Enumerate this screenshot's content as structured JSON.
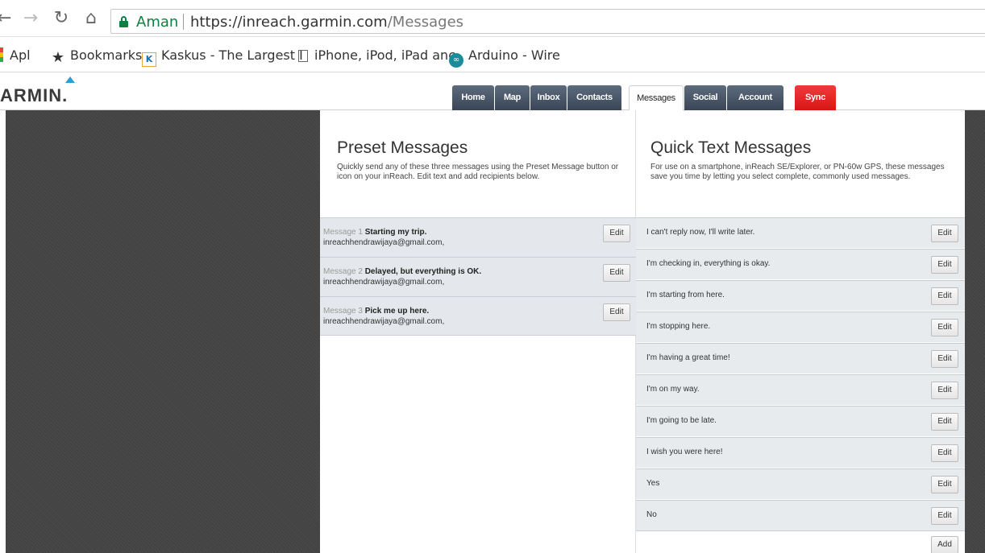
{
  "browser": {
    "secure_label": "Aman",
    "url_host": "https://inreach.garmin.com",
    "url_path": "/Messages",
    "bookmarks": [
      {
        "label": "Apl"
      },
      {
        "label": "Bookmarks"
      },
      {
        "label": "Kaskus - The Largest I"
      },
      {
        "label": "iPhone, iPod, iPad anc"
      },
      {
        "label": "Arduino - Wire"
      }
    ]
  },
  "header": {
    "logo": "ARMIN.",
    "tabs": [
      {
        "label": "Home"
      },
      {
        "label": "Map"
      },
      {
        "label": "Inbox"
      },
      {
        "label": "Contacts"
      },
      {
        "label": "Messages"
      },
      {
        "label": "Social"
      },
      {
        "label": "Account"
      },
      {
        "label": "Sync"
      }
    ]
  },
  "preset": {
    "title": "Preset Messages",
    "description": "Quickly send any of these three messages using the Preset Message button or icon on your inReach. Edit text and add recipients below.",
    "edit_label": "Edit",
    "messages": [
      {
        "prefix": "Message 1",
        "text": "Starting my trip.",
        "recipients": "inreachhendrawijaya@gmail.com,"
      },
      {
        "prefix": "Message 2",
        "text": "Delayed, but everything is OK.",
        "recipients": "inreachhendrawijaya@gmail.com,"
      },
      {
        "prefix": "Message 3",
        "text": "Pick me up here.",
        "recipients": "inreachhendrawijaya@gmail.com,"
      }
    ]
  },
  "quick": {
    "title": "Quick Text Messages",
    "description": "For use on a smartphone, inReach SE/Explorer, or PN-60w GPS, these messages save you time by letting you select complete, commonly used messages.",
    "edit_label": "Edit",
    "add_label": "Add",
    "messages": [
      {
        "text": "I can't reply now, I'll write later."
      },
      {
        "text": "I'm checking in, everything is okay."
      },
      {
        "text": "I'm starting from here."
      },
      {
        "text": "I'm stopping here."
      },
      {
        "text": "I'm having a great time!"
      },
      {
        "text": "I'm on my way."
      },
      {
        "text": "I'm going to be late."
      },
      {
        "text": "I wish you were here!"
      },
      {
        "text": "Yes"
      },
      {
        "text": "No"
      }
    ]
  }
}
